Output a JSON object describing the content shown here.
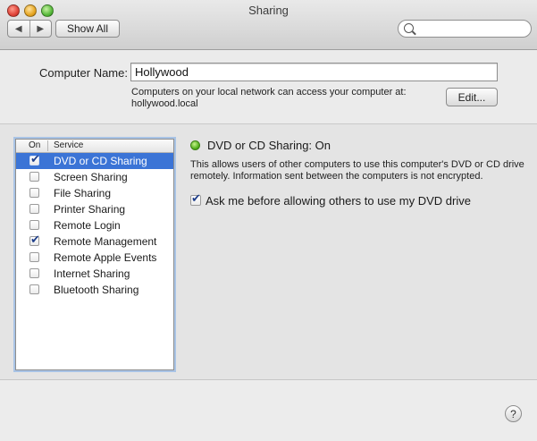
{
  "window": {
    "title": "Sharing"
  },
  "toolbar": {
    "back_icon": "◀",
    "forward_icon": "▶",
    "show_all_label": "Show All",
    "search_placeholder": ""
  },
  "computer": {
    "name_label": "Computer Name:",
    "name_value": "Hollywood",
    "help_line1": "Computers on your local network can access your computer at:",
    "help_line2": "hollywood.local",
    "edit_label": "Edit..."
  },
  "services": {
    "header_on": "On",
    "header_service": "Service",
    "items": [
      {
        "name": "DVD or CD Sharing",
        "checked": true,
        "selected": true
      },
      {
        "name": "Screen Sharing",
        "checked": false,
        "selected": false
      },
      {
        "name": "File Sharing",
        "checked": false,
        "selected": false
      },
      {
        "name": "Printer Sharing",
        "checked": false,
        "selected": false
      },
      {
        "name": "Remote Login",
        "checked": false,
        "selected": false
      },
      {
        "name": "Remote Management",
        "checked": true,
        "selected": false
      },
      {
        "name": "Remote Apple Events",
        "checked": false,
        "selected": false
      },
      {
        "name": "Internet Sharing",
        "checked": false,
        "selected": false
      },
      {
        "name": "Bluetooth Sharing",
        "checked": false,
        "selected": false
      }
    ]
  },
  "detail": {
    "status": "DVD or CD Sharing: On",
    "status_color": "#4fae1a",
    "description_line1": "This allows users of other computers to use this computer's DVD or CD drive",
    "description_line2": "remotely. Information sent between the computers is not encrypted.",
    "ask_label": "Ask me before allowing others to use my DVD drive",
    "ask_checked": true
  },
  "help": {
    "label": "?"
  },
  "colors": {
    "selection": "#3b74d6"
  }
}
